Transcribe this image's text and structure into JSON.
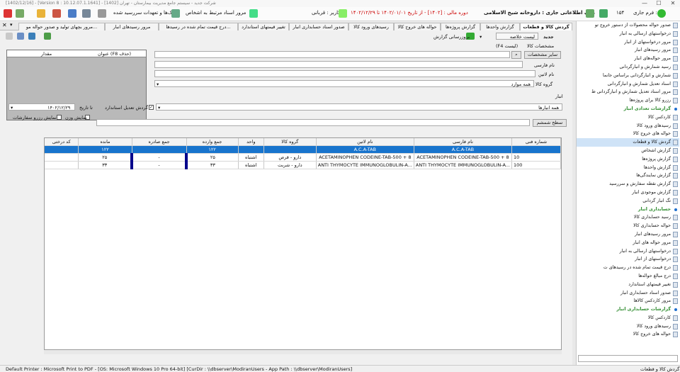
{
  "window": {
    "title": "[1402/12/16] - [Version 8 : 10.12.07.1.1641] - [1402] شرکت جدید - سیستم جامع مدیریت بیمارستان - تهران",
    "min": "—",
    "max": "☐",
    "close": "✕"
  },
  "toolbar": {
    "form_label": "فرم جاری :",
    "form_value": "۱۵۴",
    "company": "بانک اطلاعاتی جاری : داروخانه شیخ الاسلامی",
    "period": "دوره مالی : [۱۴۰۲] - از تاریخ ۱۴۰۲/۰۱/۰۱ تا ۱۴۰۲/۱۲/۲۹",
    "user": "کاربر : قربانی",
    "cheques": "چک‌ها و تعهدات سررسید شده",
    "docs": "مرور اسناد مرتبط به اشخاص"
  },
  "tabs": [
    "گردش کالا و قطعات",
    "گزارش واحدها",
    "گزارش پروژه‌ها",
    "حواله های خروج کالا",
    "رسیدهای ورود کالا",
    "صدور اسناد حسابداری انبار",
    "تغییر قیمتهای استاندارد",
    "درج قیمت تمام شده در رسیدها...",
    "مرور رسیدهای انبار",
    "مرور بچهای تولید و صدور حواله مو..."
  ],
  "report": {
    "new_label": "جدید",
    "summary_label": "لیست خلاصه",
    "update_label": "بروزرسانی گزارش",
    "item_spec": "مشخصات کالا",
    "f4": "(F4 لیست)",
    "other_spec_btn": "سایر مشخصات",
    "persian_name": "نام فارسی",
    "latin_name": "نام لاتین",
    "group_label": "گروه کالا",
    "group_value": "همه موارد",
    "field_title": "عنوان (F8 حذف)",
    "field_amount": "مقدار",
    "warehouse_label": "انبار",
    "warehouse_value": "همه انبارها",
    "std_adjust": "گردش تعدیل استاندارد",
    "to_date_label": "تا تاریخ",
    "to_date_value": "۱۴۰۲/۱۲/۲۹",
    "show_weight": "نمایش وزن",
    "show_order": "نمایش رزرو سفارشات",
    "row_level_btn": "سطح شمشم"
  },
  "grid": {
    "headers": [
      "کد درختی",
      "مانده",
      "جمع صادره",
      "جمع وارده",
      "واحد",
      "گروه کالا",
      "نام لاتین",
      "نام فارسی",
      "شماره فنی"
    ],
    "rows": [
      {
        "tree": "",
        "remain": "۱۲۲",
        "out": "",
        "in": "۱۲۲",
        "unit": "",
        "group": "",
        "latin": "A.C.A-TAB",
        "persian": "A.C.A-TAB",
        "tech": ""
      },
      {
        "tree": "",
        "remain": "۲۵",
        "out": "-",
        "in": "۲۵",
        "unit": "اشتباه",
        "group": "دارو - قرص",
        "latin": "ACETAMINOPHEN CODEINE-TAB-500 + 8",
        "persian": "ACETAMINOPHEN CODEINE-TAB-500 + 8",
        "tech": "10"
      },
      {
        "tree": "",
        "remain": "۳۳",
        "out": "-",
        "in": "۳۳",
        "unit": "اشتباه",
        "group": "دارو - شربت",
        "latin": "ANTI THYMOCYTE IMMUNOGLOBULIN-A...",
        "persian": "ANTI THYMOCYTE IMMUNOGLOBULIN-A...",
        "tech": "100"
      }
    ]
  },
  "sidebar": [
    {
      "label": "صدور حواله محصولات از دستور خروج تو",
      "hdr": false
    },
    {
      "label": "درخواستهای ارسالی به انبار",
      "hdr": false
    },
    {
      "label": "مرور درخواستهای از انبار",
      "hdr": false
    },
    {
      "label": "مرور رسیدهای انبار",
      "hdr": false
    },
    {
      "label": "مرور حواله‌های انبار",
      "hdr": false
    },
    {
      "label": "رسید شمارش و انبارگردانی",
      "hdr": false
    },
    {
      "label": "شمارش و انبارگردانی براساس جانما",
      "hdr": false
    },
    {
      "label": "اسناد تعدیل شمارش و انبارگردانی",
      "hdr": false
    },
    {
      "label": "مرور اسناد تعدیل شمارش و انبارگردانی ط",
      "hdr": false
    },
    {
      "label": "رزرو کالا برای پروژه‌ها",
      "hdr": false
    },
    {
      "label": "گزارشات تعدادی انبار",
      "hdr": true
    },
    {
      "label": "کاردکس کالا",
      "hdr": false
    },
    {
      "label": "رسیدهای ورود کالا",
      "hdr": false
    },
    {
      "label": "حواله های خروج کالا",
      "hdr": false
    },
    {
      "label": "گردش کالا و قطعات",
      "hdr": false,
      "active": true
    },
    {
      "label": "گزارش اشخاص",
      "hdr": false
    },
    {
      "label": "گزارش پروژه‌ها",
      "hdr": false
    },
    {
      "label": "گزارش واحدها",
      "hdr": false
    },
    {
      "label": "گزارش نمایندگی‌ها",
      "hdr": false
    },
    {
      "label": "گزارش نقطه سفارش و سررسید",
      "hdr": false
    },
    {
      "label": "گزارش موجودی انبار",
      "hdr": false
    },
    {
      "label": "تگ انبار گردانی",
      "hdr": false
    },
    {
      "label": "حسابداری انبار",
      "hdr": true
    },
    {
      "label": "رسید حسابداری کالا",
      "hdr": false
    },
    {
      "label": "حواله حسابداری کالا",
      "hdr": false
    },
    {
      "label": "مرور رسیدهای انبار",
      "hdr": false
    },
    {
      "label": "مرور حواله های انبار",
      "hdr": false
    },
    {
      "label": "درخواستهای ارسالی به انبار",
      "hdr": false
    },
    {
      "label": "درخواستهای از انبار",
      "hdr": false
    },
    {
      "label": "درج قیمت تمام شده در رسیدهای ت",
      "hdr": false
    },
    {
      "label": "درج مبالغ حواله‌ها",
      "hdr": false
    },
    {
      "label": "تغییر قیمتهای استاندارد",
      "hdr": false
    },
    {
      "label": "صدور اسناد حسابداری انبار",
      "hdr": false
    },
    {
      "label": "مرور کاردکس کالاها",
      "hdr": false
    },
    {
      "label": "گزارشات حسابداری انبار",
      "hdr": true
    },
    {
      "label": "کاردکس کالا",
      "hdr": false
    },
    {
      "label": "رسیدهای ورود کالا",
      "hdr": false
    },
    {
      "label": "حواله های خروج کالا",
      "hdr": false
    }
  ],
  "status": {
    "left": "Default Printer : Microsoft Print to PDF - [OS: Microsoft Windows 10 Pro 64-bit]  [CurDir : \\\\dbserver\\ModiranUsers - App Path : \\\\dbserver\\ModiranUsers]",
    "right": "گردش کالا و قطعات"
  }
}
